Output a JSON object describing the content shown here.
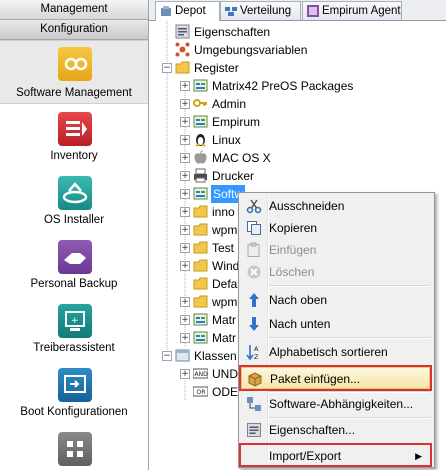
{
  "nav": {
    "headers": [
      "Management",
      "Konfiguration"
    ],
    "items": [
      {
        "label": "Software Management",
        "icon": "software-management-icon",
        "active": true
      },
      {
        "label": "Inventory",
        "icon": "inventory-icon"
      },
      {
        "label": "OS Installer",
        "icon": "os-installer-icon"
      },
      {
        "label": "Personal Backup",
        "icon": "personal-backup-icon"
      },
      {
        "label": "Treiberassistent",
        "icon": "treiberassistent-icon"
      },
      {
        "label": "Boot Konfigurationen",
        "icon": "boot-konfigurationen-icon"
      }
    ]
  },
  "tabs": [
    {
      "label": "Depot",
      "icon": "depot-icon",
      "active": true
    },
    {
      "label": "Verteilung",
      "icon": "verteilung-icon"
    },
    {
      "label": "Empirum Agent",
      "icon": "empirum-agent-icon"
    }
  ],
  "tree": [
    {
      "label": "Eigenschaften",
      "icon": "properties-icon"
    },
    {
      "label": "Umgebungsvariablen",
      "icon": "variables-icon"
    },
    {
      "label": "Register",
      "icon": "folder-icon",
      "expanded": true
    },
    {
      "label": "Matrix42 PreOS Packages",
      "icon": "package-icon"
    },
    {
      "label": "Admin",
      "icon": "key-icon"
    },
    {
      "label": "Empirum",
      "icon": "package-icon"
    },
    {
      "label": "Linux",
      "icon": "linux-icon"
    },
    {
      "label": "MAC OS X",
      "icon": "apple-icon"
    },
    {
      "label": "Drucker",
      "icon": "printer-icon"
    },
    {
      "label": "Softw",
      "icon": "package-icon",
      "selected": true
    },
    {
      "label": "inno",
      "icon": "folder-icon"
    },
    {
      "label": "wpm",
      "icon": "folder-icon"
    },
    {
      "label": "Test",
      "icon": "folder-icon"
    },
    {
      "label": "Wind",
      "icon": "folder-icon"
    },
    {
      "label": "Defa",
      "icon": "folder-icon"
    },
    {
      "label": "wpm",
      "icon": "folder-icon"
    },
    {
      "label": "Matr",
      "icon": "package-icon"
    },
    {
      "label": "Matr",
      "icon": "package-icon"
    },
    {
      "label": "Klassen",
      "icon": "classes-icon",
      "expanded": true
    },
    {
      "label": "UND",
      "icon": "and-icon"
    },
    {
      "label": "ODE",
      "icon": "or-icon"
    }
  ],
  "context_menu": [
    {
      "label": "Ausschneiden",
      "icon": "scissors-icon"
    },
    {
      "label": "Kopieren",
      "icon": "copy-icon"
    },
    {
      "label": "Einfügen",
      "icon": "paste-icon",
      "disabled": true
    },
    {
      "label": "Löschen",
      "icon": "delete-icon",
      "disabled": true
    },
    {
      "label": "Nach oben",
      "icon": "arrow-up-icon"
    },
    {
      "label": "Nach unten",
      "icon": "arrow-down-icon"
    },
    {
      "label": "Alphabetisch sortieren",
      "icon": "sort-az-icon"
    },
    {
      "label": "Paket einfügen...",
      "icon": "package-insert-icon",
      "highlighted": true
    },
    {
      "label": "Software-Abhängigkeiten...",
      "icon": "dependencies-icon"
    },
    {
      "label": "Eigenschaften...",
      "icon": "properties-icon"
    },
    {
      "label": "Import/Export",
      "icon": "",
      "submenu": true
    }
  ],
  "colors": {
    "accent_red": "#d9333a",
    "selection_blue": "#3399ff",
    "menu_highlight": "#f6e6a9"
  }
}
